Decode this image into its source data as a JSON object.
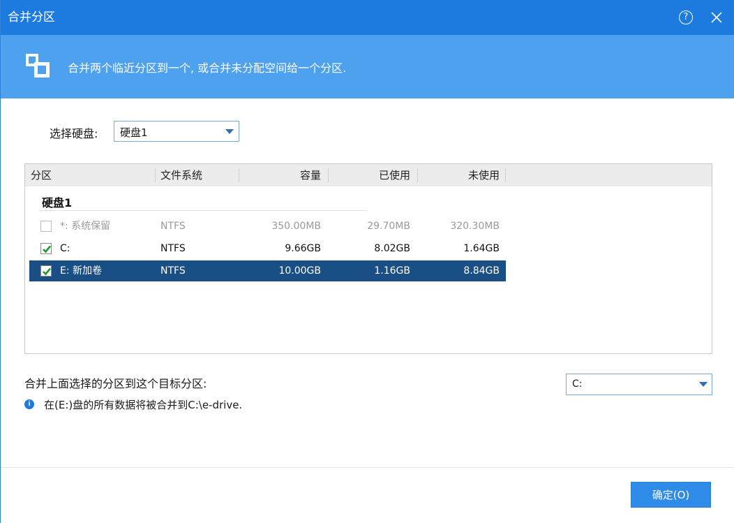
{
  "window": {
    "title": "合并分区",
    "help_label": "?",
    "banner_text": "合并两个临近分区到一个, 或合并未分配空间给一个分区."
  },
  "disk_selector": {
    "label": "选择硬盘:",
    "value": "硬盘1"
  },
  "table": {
    "columns": [
      "分区",
      "文件系统",
      "容量",
      "已使用",
      "未使用"
    ],
    "group_label": "硬盘1",
    "rows": [
      {
        "checked": false,
        "disabled": true,
        "selected": false,
        "partition": "*: 系统保留",
        "fs": "NTFS",
        "capacity": "350.00MB",
        "used": "29.70MB",
        "unused": "320.30MB"
      },
      {
        "checked": true,
        "disabled": false,
        "selected": false,
        "partition": "C:",
        "fs": "NTFS",
        "capacity": "9.66GB",
        "used": "8.02GB",
        "unused": "1.64GB"
      },
      {
        "checked": true,
        "disabled": false,
        "selected": true,
        "partition": "E: 新加卷",
        "fs": "NTFS",
        "capacity": "10.00GB",
        "used": "1.16GB",
        "unused": "8.84GB"
      }
    ]
  },
  "target": {
    "label": "合并上面选择的分区到这个目标分区:",
    "value": "C:"
  },
  "info": {
    "icon_glyph": "i",
    "text": "在(E:)盘的所有数据将被合并到C:\\e-drive."
  },
  "footer": {
    "ok_label": "确定(O)"
  },
  "colors": {
    "titlebar": "#1d7be0",
    "banner": "#4da1ef",
    "selected_row": "#1a4f86",
    "ok_button": "#2f8be8",
    "checkmark": "#1f9a2e"
  }
}
